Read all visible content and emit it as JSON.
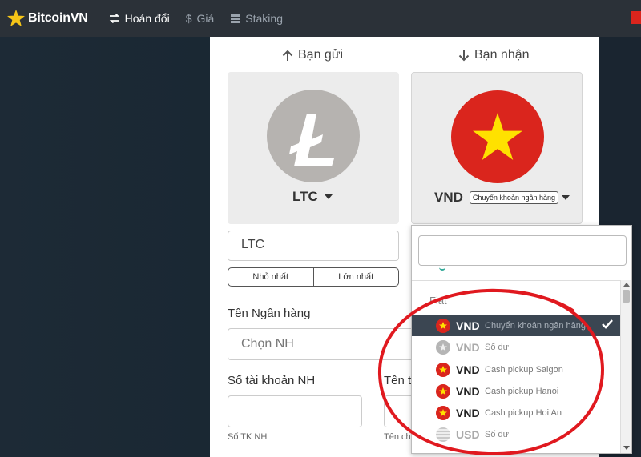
{
  "brand": {
    "name": "BitcoinVN"
  },
  "nav": [
    {
      "label": "Hoán đổi",
      "icon": "swap-icon",
      "active": true
    },
    {
      "label": "Giá",
      "icon": "dollar-icon",
      "active": false
    },
    {
      "label": "Staking",
      "icon": "stack-icon",
      "active": false
    }
  ],
  "send": {
    "direction_label": "Bạn gửi",
    "coin": "LTC",
    "amount_value": "LTC"
  },
  "receive": {
    "direction_label": "Bạn nhận",
    "coin": "VND",
    "method": "Chuyển khoản ngân hàng"
  },
  "limits": {
    "min_label": "Nhỏ nhất",
    "max_label": "Lớn nhất"
  },
  "bank": {
    "label": "Tên Ngân hàng",
    "placeholder": "Chọn NH"
  },
  "account": {
    "label": "Số tài khoản NH",
    "hint": "Số TK NH"
  },
  "owner": {
    "label": "Tên t",
    "hint": "Tên ch"
  },
  "dropdown": {
    "group": "Fiat",
    "items": [
      {
        "code": "VND",
        "desc": "Chuyển khoản ngân hàng",
        "flag": "vietnam-flag-icon",
        "selected": true
      },
      {
        "code": "VND",
        "desc": "Số dư",
        "flag": "vietnam-flag-icon",
        "muted": true
      },
      {
        "code": "VND",
        "desc": "Cash pickup Saigon",
        "flag": "vietnam-flag-icon"
      },
      {
        "code": "VND",
        "desc": "Cash pickup Hanoi",
        "flag": "vietnam-flag-icon"
      },
      {
        "code": "VND",
        "desc": "Cash pickup Hoi An",
        "flag": "vietnam-flag-icon"
      },
      {
        "code": "USD",
        "desc": "Số dư",
        "flag": "usa-flag-icon",
        "muted": true
      }
    ]
  },
  "colors": {
    "navbar": "#2b3138",
    "selected_row": "#3b4652",
    "vietnam_red": "#da251d",
    "vietnam_star": "#ffe100",
    "ltc_grey": "#b6b3b0",
    "annotation_red": "#e0191f"
  }
}
